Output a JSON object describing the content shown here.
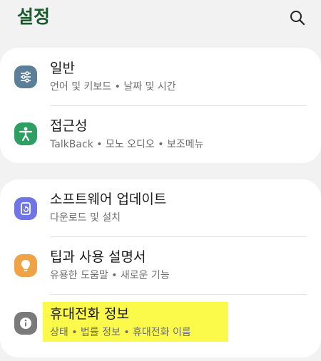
{
  "header": {
    "title": "설정",
    "search_icon": "search-icon"
  },
  "colors": {
    "background": "#f2f2f2",
    "card": "#ffffff",
    "title": "#1a5b2e",
    "highlight": "#fbf94a"
  },
  "sections": [
    {
      "items": [
        {
          "title": "일반",
          "subtitle": "언어 및 키보드 • 날짜 및 시간",
          "icon": "sliders-icon",
          "icon_color": "#5c7f99"
        },
        {
          "title": "접근성",
          "subtitle": "TalkBack • 모노 오디오 • 보조메뉴",
          "icon": "accessibility-icon",
          "icon_color": "#2f9e63"
        }
      ]
    },
    {
      "items": [
        {
          "title": "소프트웨어 업데이트",
          "subtitle": "다운로드 및 설치",
          "icon": "update-icon",
          "icon_color": "#6f74e6"
        },
        {
          "title": "팁과 사용 설명서",
          "subtitle": "유용한 도움말 • 새로운 기능",
          "icon": "lightbulb-icon",
          "icon_color": "#f0a346"
        },
        {
          "title": "휴대전화 정보",
          "subtitle": "상태 • 법률 정보 • 휴대전화 이름",
          "icon": "info-icon",
          "icon_color": "#7a7a7a",
          "highlighted": true
        }
      ]
    }
  ]
}
